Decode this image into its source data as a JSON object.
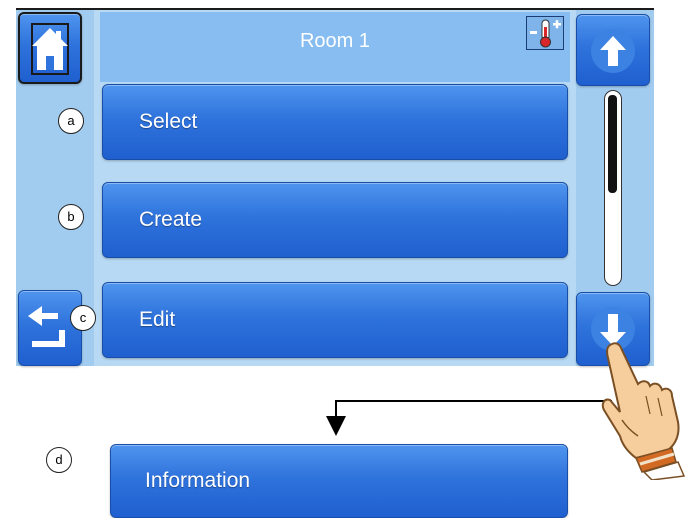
{
  "header": {
    "title": "Room 1",
    "home_icon": "home-icon",
    "temp_icon": "thermometer-plus-icon"
  },
  "menu": {
    "items": [
      {
        "label": "Select",
        "marker": "a"
      },
      {
        "label": "Create",
        "marker": "b"
      },
      {
        "label": "Edit",
        "marker": "c"
      }
    ],
    "extra_item": {
      "label": "Information",
      "marker": "d"
    }
  },
  "nav": {
    "up_icon": "arrow-up-icon",
    "down_icon": "arrow-down-icon",
    "back_icon": "back-arrow-icon"
  },
  "annotation": {
    "hand_icon": "pointing-hand-icon"
  },
  "colors": {
    "button_blue": "#2f73dc",
    "panel_light": "#b7d9f3",
    "side_panel": "#a2ccef"
  }
}
